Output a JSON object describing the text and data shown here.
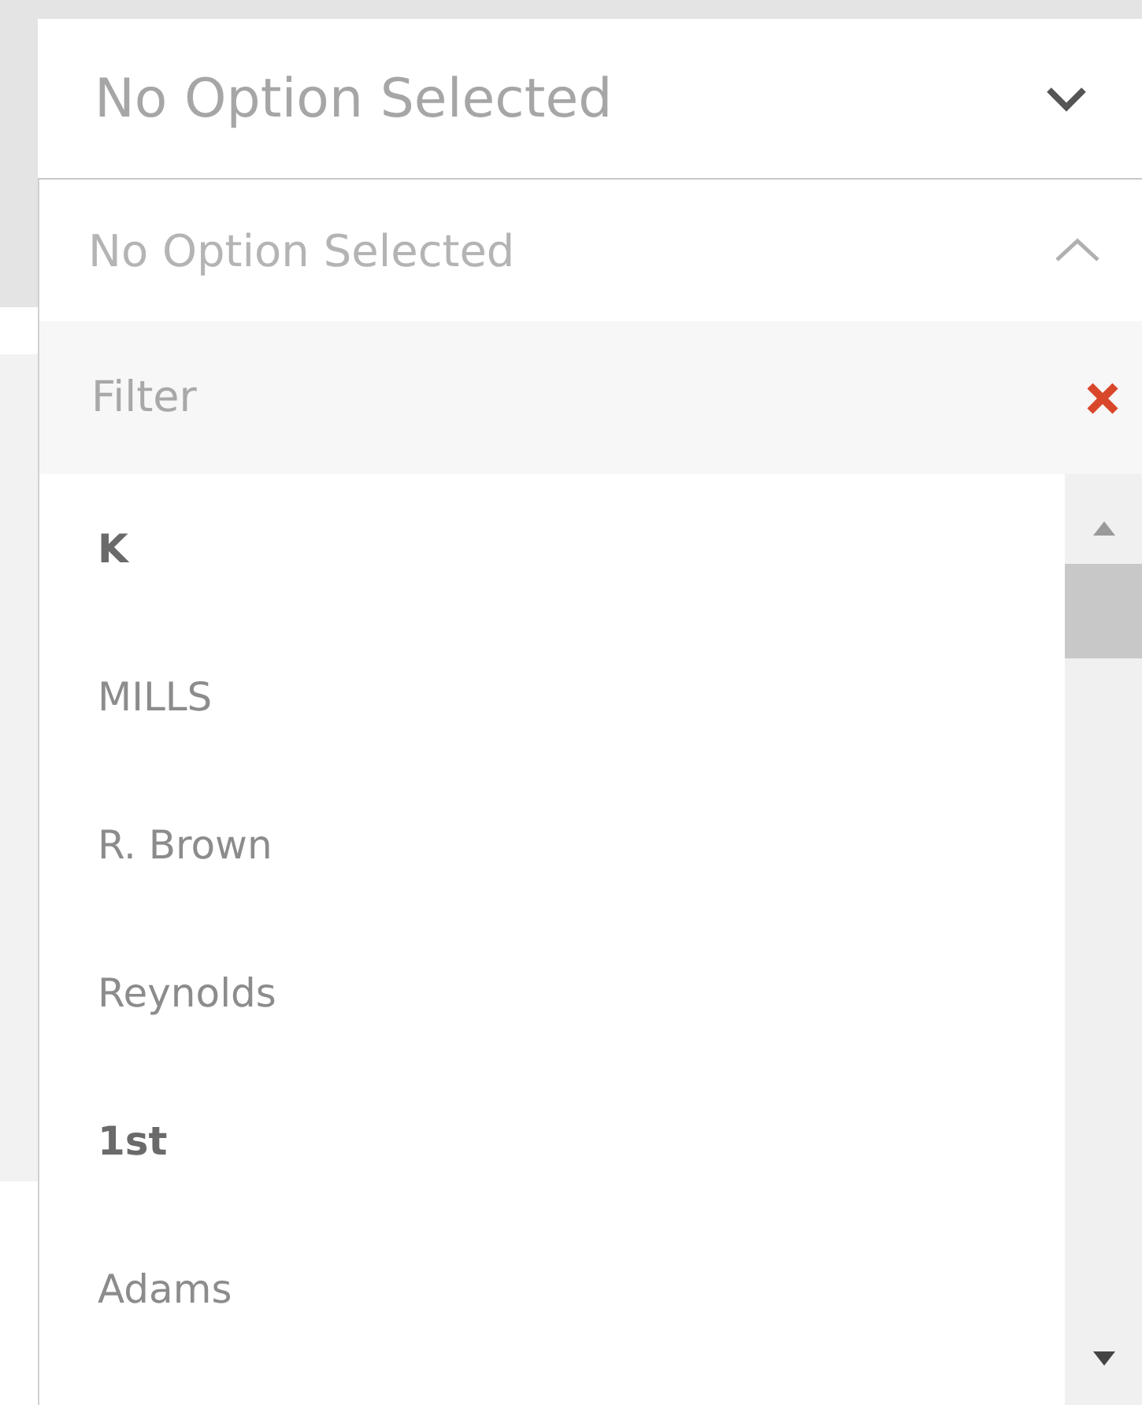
{
  "select": {
    "value": "No Option Selected",
    "expanded": true
  },
  "dropdown": {
    "header": "No Option Selected",
    "filter": {
      "placeholder": "Filter"
    },
    "items": [
      {
        "label": "K",
        "kind": "group"
      },
      {
        "label": "MILLS",
        "kind": "option"
      },
      {
        "label": "R. Brown",
        "kind": "option"
      },
      {
        "label": "Reynolds",
        "kind": "option"
      },
      {
        "label": "1st",
        "kind": "group"
      },
      {
        "label": "Adams",
        "kind": "option"
      }
    ]
  }
}
